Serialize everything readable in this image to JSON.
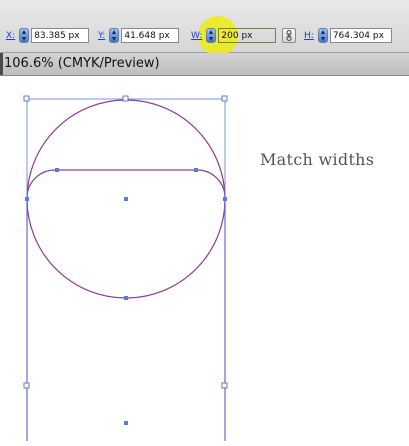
{
  "control_bar": {
    "x": {
      "label": "X:",
      "value": "83.385 px"
    },
    "y": {
      "label": "Y:",
      "value": "41.648 px"
    },
    "w": {
      "label": "W:",
      "value": "200 px"
    },
    "h": {
      "label": "H:",
      "value": "764.304 px"
    },
    "constrain_icon": "link-icon",
    "accent_color": "#1b3fd6"
  },
  "document_tab": {
    "title": "106.6% (CMYK/Preview)"
  },
  "canvas": {
    "annotation": "Match widths",
    "path_color": "#b0287a",
    "selection_color": "#5b7ad6",
    "highlight_color": "#ecec12"
  }
}
